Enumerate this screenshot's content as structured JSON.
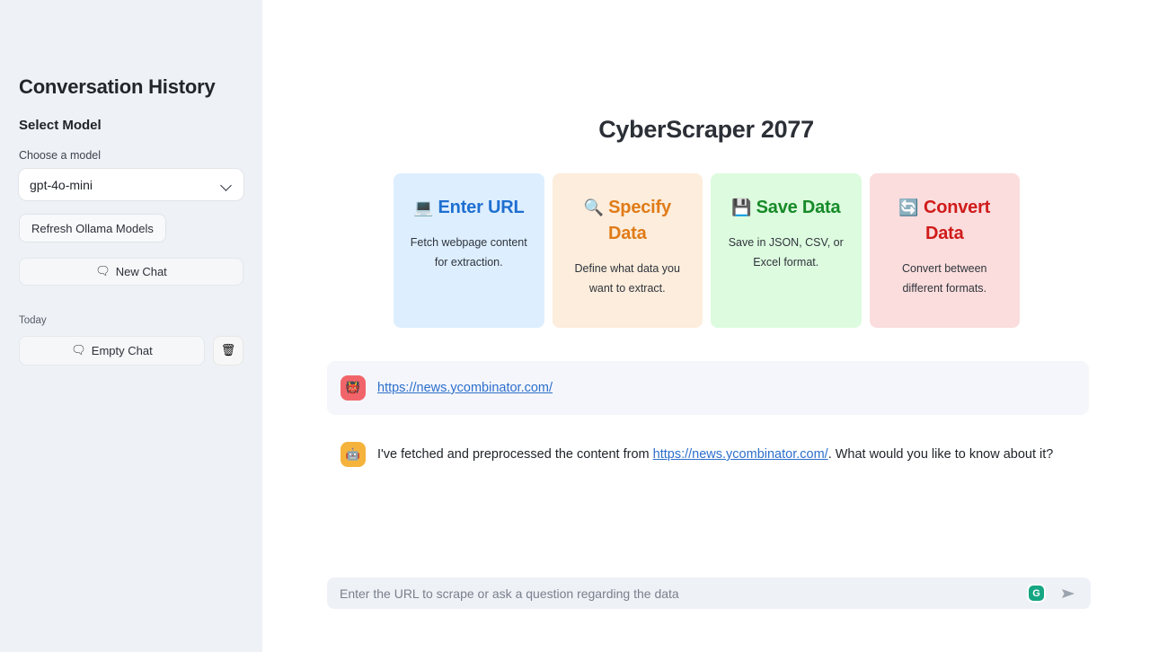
{
  "sidebar": {
    "title": "Conversation History",
    "select_model_heading": "Select Model",
    "choose_label": "Choose a model",
    "selected_model": "gpt-4o-mini",
    "chevron_icon": "chevron-down-icon",
    "refresh_label": "Refresh Ollama Models",
    "new_chat_icon": "🗨",
    "new_chat_label": "New Chat",
    "today_label": "Today",
    "chats": [
      {
        "icon": "🗨",
        "label": "Empty Chat",
        "delete_icon": "🗑"
      }
    ]
  },
  "main": {
    "title": "CyberScraper 2077",
    "cards": [
      {
        "icon": "💻",
        "icon_name": "laptop-icon",
        "heading": "Enter URL",
        "description": "Fetch webpage content for extraction.",
        "bg": "#ddeeff",
        "fg": "#1f6fd0"
      },
      {
        "icon": "🔍",
        "icon_name": "magnifier-icon",
        "heading": "Specify Data",
        "description": "Define what data you want to extract.",
        "bg": "#fceddc",
        "fg": "#e07b18"
      },
      {
        "icon": "💾",
        "icon_name": "floppy-disk-icon",
        "heading": "Save Data",
        "description": "Save in JSON, CSV, or Excel format.",
        "bg": "#ddfbdf",
        "fg": "#168a28"
      },
      {
        "icon": "🔄",
        "icon_name": "refresh-cycle-icon",
        "heading": "Convert Data",
        "description": "Convert between different formats.",
        "bg": "#fbdddd",
        "fg": "#d01b1b"
      }
    ],
    "messages": [
      {
        "role": "user",
        "avatar_icon": "👹",
        "avatar_color": "#f1656a",
        "text_before": "",
        "link": "https://news.ycombinator.com/",
        "text_after": ""
      },
      {
        "role": "assistant",
        "avatar_icon": "🤖",
        "avatar_color": "#f5b33c",
        "text_before": "I've fetched and preprocessed the content from ",
        "link": "https://news.ycombinator.com/",
        "text_after": ". What would you like to know about it?"
      }
    ],
    "input": {
      "placeholder": "Enter the URL to scrape or ask a question regarding the data",
      "value": "",
      "grammarly_label": "G",
      "send_icon": "send-icon"
    }
  }
}
